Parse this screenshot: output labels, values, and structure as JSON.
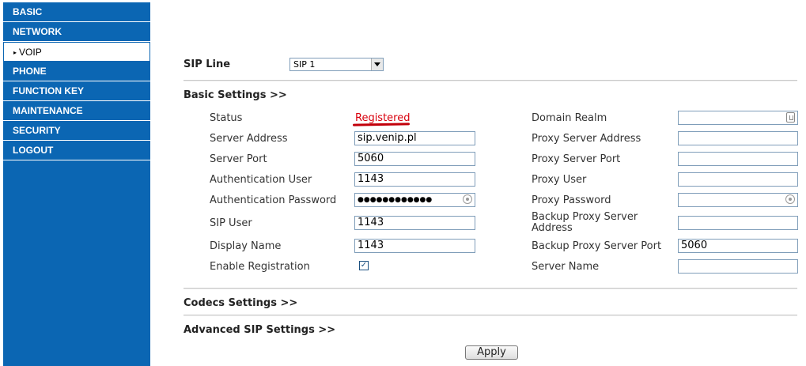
{
  "sidebar": {
    "items": [
      {
        "label": "BASIC"
      },
      {
        "label": "NETWORK"
      },
      {
        "label": "VOIP",
        "active": true
      },
      {
        "label": "PHONE"
      },
      {
        "label": "FUNCTION KEY"
      },
      {
        "label": "MAINTENANCE"
      },
      {
        "label": "SECURITY"
      },
      {
        "label": "LOGOUT"
      }
    ],
    "active_marker": "▸"
  },
  "sip_line": {
    "label": "SIP Line",
    "selected": "SIP 1"
  },
  "sections": {
    "basic": "Basic Settings >>",
    "codecs": "Codecs Settings >>",
    "advanced": "Advanced SIP Settings >>"
  },
  "left": {
    "status": {
      "label": "Status",
      "value": "Registered"
    },
    "server_address": {
      "label": "Server Address",
      "value": "sip.venip.pl"
    },
    "server_port": {
      "label": "Server Port",
      "value": "5060"
    },
    "auth_user": {
      "label": "Authentication User",
      "value": "1143"
    },
    "auth_password": {
      "label": "Authentication Password",
      "value": "●●●●●●●●●●●●"
    },
    "sip_user": {
      "label": "SIP User",
      "value": "1143"
    },
    "display_name": {
      "label": "Display Name",
      "value": "1143"
    },
    "enable_registration": {
      "label": "Enable Registration",
      "checked": true,
      "check_glyph": "✓"
    }
  },
  "right": {
    "domain_realm": {
      "label": "Domain Realm",
      "value": ""
    },
    "proxy_server_address": {
      "label": "Proxy Server Address",
      "value": ""
    },
    "proxy_server_port": {
      "label": "Proxy Server Port",
      "value": ""
    },
    "proxy_user": {
      "label": "Proxy User",
      "value": ""
    },
    "proxy_password": {
      "label": "Proxy Password",
      "value": ""
    },
    "backup_proxy_address": {
      "label_line1": "Backup Proxy Server",
      "label_line2": "Address",
      "value": ""
    },
    "backup_proxy_port": {
      "label": "Backup Proxy Server Port",
      "value": "5060"
    },
    "server_name": {
      "label": "Server Name",
      "value": ""
    }
  },
  "apply_label": "Apply",
  "colors": {
    "sidebar": "#0b66b3",
    "status_registered": "#d9000d"
  }
}
